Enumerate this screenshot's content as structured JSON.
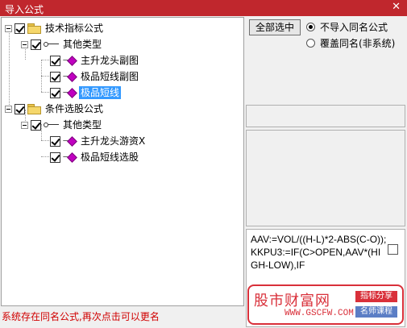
{
  "window": {
    "title": "导入公式",
    "close_glyph": "✕"
  },
  "tree": {
    "groups": [
      {
        "label": "技术指标公式",
        "sub": {
          "label": "其他类型",
          "items": [
            "主升龙头副图",
            "极品短线副图",
            "极品短线"
          ]
        }
      },
      {
        "label": "条件选股公式",
        "sub": {
          "label": "其他类型",
          "items": [
            "主升龙头游资X",
            "极品短线选股"
          ]
        }
      }
    ],
    "selected_item": "极品短线"
  },
  "controls": {
    "select_all": "全部选中",
    "radio_skip": "不导入同名公式",
    "radio_overwrite": "覆盖同名(非系统)"
  },
  "code_preview": "AAV:=VOL/((H-L)*2-ABS(C-O));\nKKPU3:=IF(C>OPEN,AAV*(HIGH-LOW),IF",
  "watermark": {
    "name": "股市财富网",
    "url": "WWW.GSCFW.COM",
    "tag1": "指标分享",
    "tag2": "名师课程"
  },
  "status": "系统存在同名公式,再次点击可以更名"
}
